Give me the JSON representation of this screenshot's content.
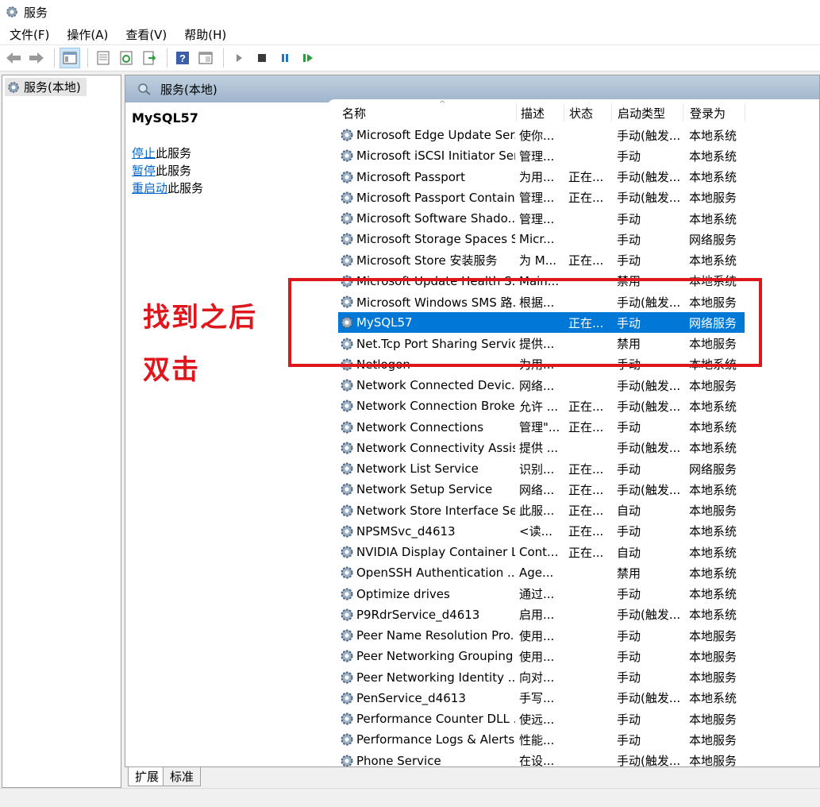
{
  "window": {
    "title": "服务"
  },
  "menu": [
    "文件(F)",
    "操作(A)",
    "查看(V)",
    "帮助(H)"
  ],
  "toolbar": {
    "icons": [
      "back-arrow-icon",
      "forward-arrow-icon",
      "show-hide-console-tree-icon",
      "properties-icon",
      "refresh-icon",
      "export-list-icon",
      "help-icon",
      "console-view-icon",
      "start-service-icon",
      "stop-service-icon",
      "pause-service-icon",
      "resume-service-icon"
    ]
  },
  "tree": {
    "root_label": "服务(本地)"
  },
  "pane_header": {
    "title": "服务(本地)"
  },
  "detail": {
    "service_name": "MySQL57",
    "actions": [
      {
        "link": "停止",
        "suffix": "此服务"
      },
      {
        "link": "暂停",
        "suffix": "此服务"
      },
      {
        "link": "重启动",
        "suffix": "此服务"
      }
    ]
  },
  "columns": {
    "name": "名称",
    "description": "描述",
    "status": "状态",
    "startup": "启动类型",
    "logon": "登录为"
  },
  "services": [
    {
      "name": "Microsoft Edge Update Ser...",
      "desc": "使你...",
      "status": "",
      "startup": "手动(触发...",
      "logon": "本地系统"
    },
    {
      "name": "Microsoft iSCSI Initiator Ser...",
      "desc": "管理...",
      "status": "",
      "startup": "手动",
      "logon": "本地系统"
    },
    {
      "name": "Microsoft Passport",
      "desc": "为用...",
      "status": "正在...",
      "startup": "手动(触发...",
      "logon": "本地系统"
    },
    {
      "name": "Microsoft Passport Container",
      "desc": "管理...",
      "status": "正在...",
      "startup": "手动(触发...",
      "logon": "本地服务"
    },
    {
      "name": "Microsoft Software Shado...",
      "desc": "管理...",
      "status": "",
      "startup": "手动",
      "logon": "本地系统"
    },
    {
      "name": "Microsoft Storage Spaces S...",
      "desc": "Micr...",
      "status": "",
      "startup": "手动",
      "logon": "网络服务"
    },
    {
      "name": "Microsoft Store 安装服务",
      "desc": "为 M...",
      "status": "正在...",
      "startup": "手动",
      "logon": "本地系统"
    },
    {
      "name": "Microsoft Update Health S...",
      "desc": "Main...",
      "status": "",
      "startup": "禁用",
      "logon": "本地系统"
    },
    {
      "name": "Microsoft Windows SMS 路...",
      "desc": "根据...",
      "status": "",
      "startup": "手动(触发...",
      "logon": "本地服务"
    },
    {
      "name": "MySQL57",
      "desc": "",
      "status": "正在...",
      "startup": "手动",
      "logon": "网络服务",
      "selected": true
    },
    {
      "name": "Net.Tcp Port Sharing Service",
      "desc": "提供...",
      "status": "",
      "startup": "禁用",
      "logon": "本地服务"
    },
    {
      "name": "Netlogon",
      "desc": "为用...",
      "status": "",
      "startup": "手动",
      "logon": "本地系统"
    },
    {
      "name": "Network Connected Devic...",
      "desc": "网络...",
      "status": "",
      "startup": "手动(触发...",
      "logon": "本地服务"
    },
    {
      "name": "Network Connection Broker",
      "desc": "允许 ...",
      "status": "正在...",
      "startup": "手动(触发...",
      "logon": "本地系统"
    },
    {
      "name": "Network Connections",
      "desc": "管理\"...",
      "status": "正在...",
      "startup": "手动",
      "logon": "本地系统"
    },
    {
      "name": "Network Connectivity Assis...",
      "desc": "提供 ...",
      "status": "",
      "startup": "手动(触发...",
      "logon": "本地系统"
    },
    {
      "name": "Network List Service",
      "desc": "识别...",
      "status": "正在...",
      "startup": "手动",
      "logon": "网络服务"
    },
    {
      "name": "Network Setup Service",
      "desc": "网络...",
      "status": "正在...",
      "startup": "手动(触发...",
      "logon": "本地系统"
    },
    {
      "name": "Network Store Interface Se...",
      "desc": "此服...",
      "status": "正在...",
      "startup": "自动",
      "logon": "本地服务"
    },
    {
      "name": "NPSMSvc_d4613",
      "desc": "<读...",
      "status": "正在...",
      "startup": "手动",
      "logon": "本地系统"
    },
    {
      "name": "NVIDIA Display Container LS",
      "desc": "Cont...",
      "status": "正在...",
      "startup": "自动",
      "logon": "本地系统"
    },
    {
      "name": "OpenSSH Authentication ...",
      "desc": "Age...",
      "status": "",
      "startup": "禁用",
      "logon": "本地系统"
    },
    {
      "name": "Optimize drives",
      "desc": "通过...",
      "status": "",
      "startup": "手动",
      "logon": "本地系统"
    },
    {
      "name": "P9RdrService_d4613",
      "desc": "启用...",
      "status": "",
      "startup": "手动(触发...",
      "logon": "本地系统"
    },
    {
      "name": "Peer Name Resolution Pro...",
      "desc": "使用...",
      "status": "",
      "startup": "手动",
      "logon": "本地服务"
    },
    {
      "name": "Peer Networking Grouping",
      "desc": "使用...",
      "status": "",
      "startup": "手动",
      "logon": "本地服务"
    },
    {
      "name": "Peer Networking Identity ...",
      "desc": "向对...",
      "status": "",
      "startup": "手动",
      "logon": "本地服务"
    },
    {
      "name": "PenService_d4613",
      "desc": "手写...",
      "status": "",
      "startup": "手动(触发...",
      "logon": "本地系统"
    },
    {
      "name": "Performance Counter DLL ...",
      "desc": "使远...",
      "status": "",
      "startup": "手动",
      "logon": "本地服务"
    },
    {
      "name": "Performance Logs & Alerts",
      "desc": "性能...",
      "status": "",
      "startup": "手动",
      "logon": "本地服务"
    },
    {
      "name": "Phone Service",
      "desc": "在设...",
      "status": "",
      "startup": "手动(触发...",
      "logon": "本地服务"
    }
  ],
  "tabs": {
    "extended": "扩展",
    "standard": "标准"
  },
  "annotation": {
    "line1": "找到之后",
    "line2": "双击",
    "color": "#e0161d"
  },
  "colors": {
    "selection": "#0078d7",
    "link": "#0066cc",
    "header": "#a9bed3"
  }
}
